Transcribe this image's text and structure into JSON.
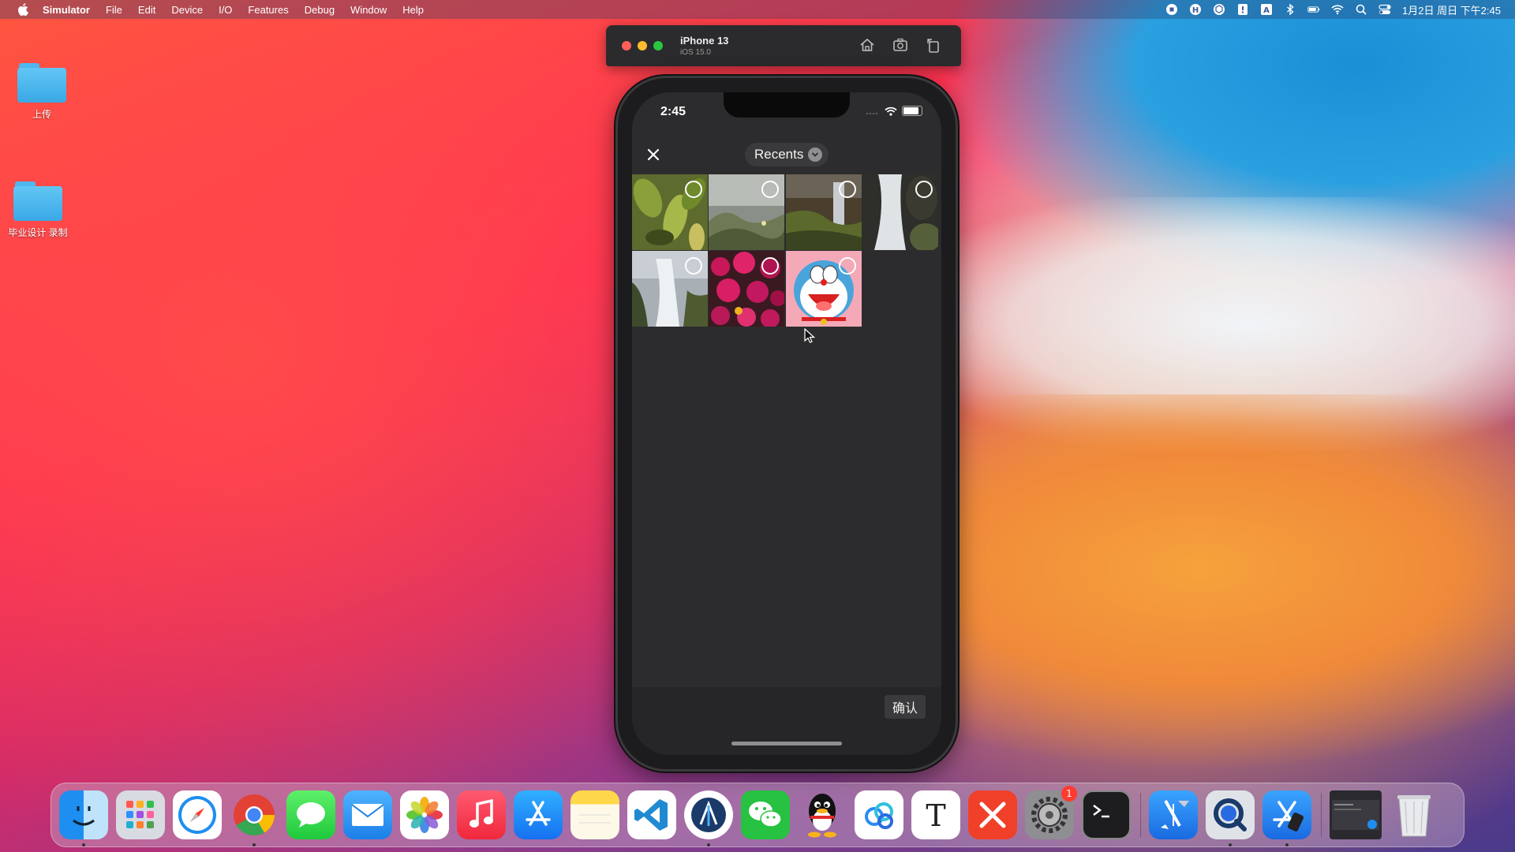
{
  "menubar": {
    "app_name": "Simulator",
    "items": [
      "File",
      "Edit",
      "Device",
      "I/O",
      "Features",
      "Debug",
      "Window",
      "Help"
    ],
    "clock": "1月2日 周日 下午2:45"
  },
  "desktop": {
    "folders": [
      {
        "label": "上传"
      },
      {
        "label": "毕业设计 录制"
      }
    ]
  },
  "simulator": {
    "device_name": "iPhone 13",
    "os_version": "iOS 15.0"
  },
  "phone": {
    "status_time": "2:45",
    "album_label": "Recents",
    "confirm_label": "确认",
    "photos": [
      {
        "icon": "leaves-photo",
        "selected": false
      },
      {
        "icon": "grass-photo",
        "selected": false
      },
      {
        "icon": "waterfall-cliff-photo",
        "selected": false
      },
      {
        "icon": "waterfall-rocks-photo",
        "selected": false
      },
      {
        "icon": "waterfall-mist-photo",
        "selected": false
      },
      {
        "icon": "pink-flowers-photo",
        "selected": false
      },
      {
        "icon": "doraemon-photo",
        "selected": false
      }
    ]
  },
  "dock": {
    "apps": [
      "finder",
      "launchpad",
      "safari",
      "chrome",
      "messages",
      "mail",
      "photos",
      "music",
      "app-store",
      "notes",
      "vscode",
      "xcode-instruments",
      "wechat",
      "qq",
      "baidu-netdisk",
      "typora",
      "xmind",
      "system-preferences",
      "terminal",
      "xcode",
      "quicktime",
      "simulator",
      "screen-recording",
      "trash"
    ],
    "system_preferences_badge": "1"
  },
  "colors": {
    "accent_red": "#ff3b30",
    "picker_bg": "#2c2c2e"
  }
}
